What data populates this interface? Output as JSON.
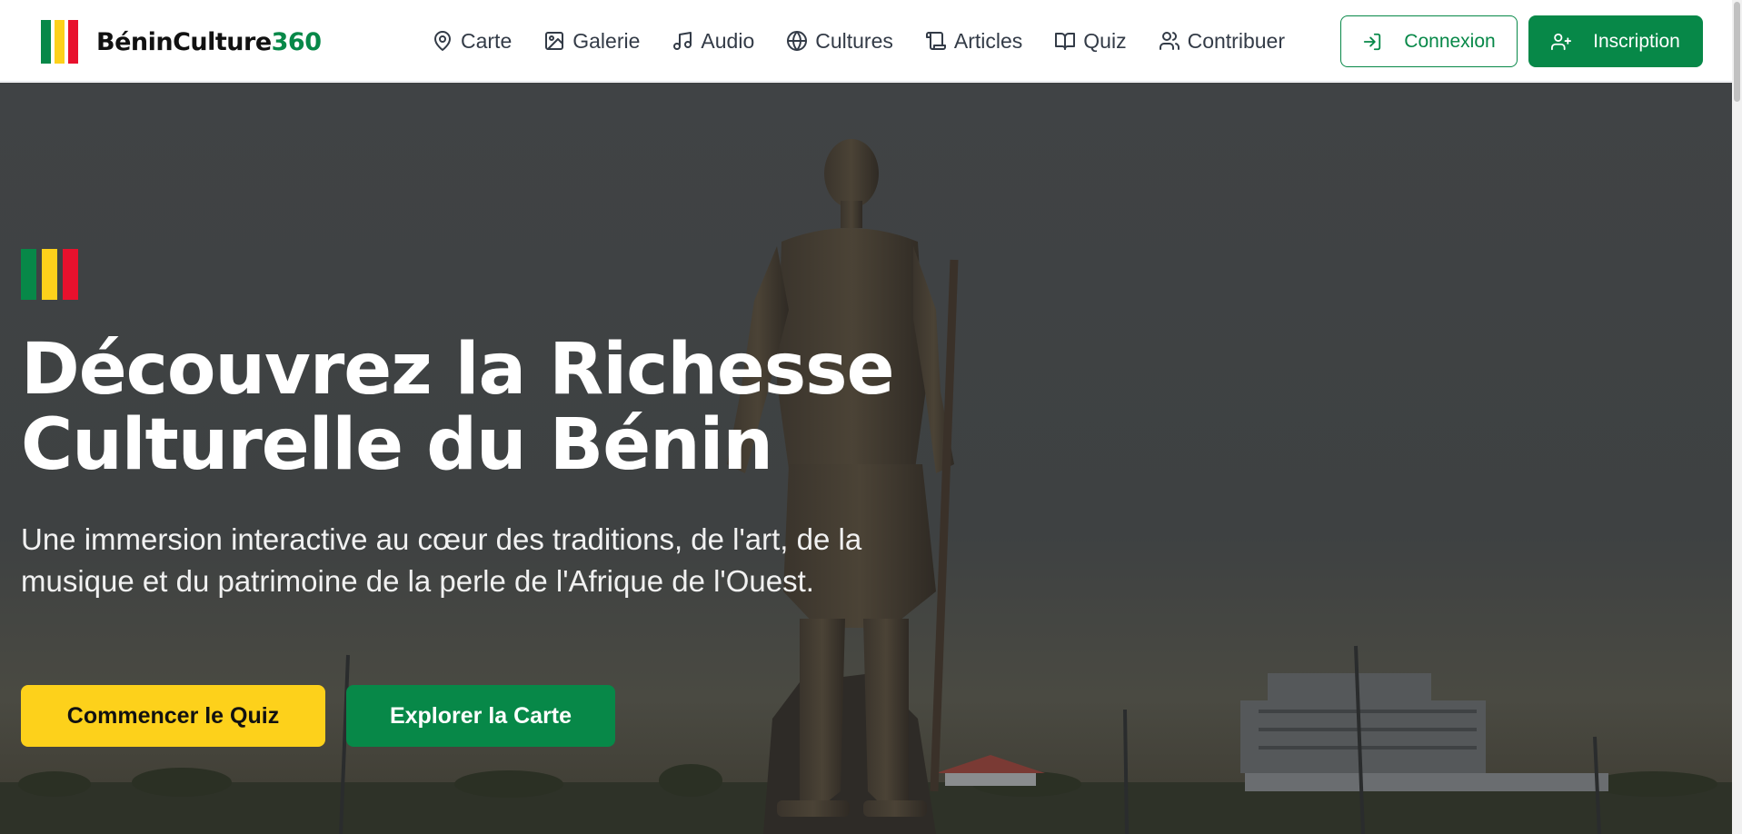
{
  "brand": {
    "name": "BéninCulture",
    "suffix": "360",
    "flag_colors": [
      "#078848",
      "#fdd11b",
      "#e8112d"
    ]
  },
  "nav": {
    "items": [
      {
        "label": "Carte",
        "icon": "map-pin-icon"
      },
      {
        "label": "Galerie",
        "icon": "image-icon"
      },
      {
        "label": "Audio",
        "icon": "music-icon"
      },
      {
        "label": "Cultures",
        "icon": "globe-icon"
      },
      {
        "label": "Articles",
        "icon": "scroll-icon"
      },
      {
        "label": "Quiz",
        "icon": "book-open-icon"
      },
      {
        "label": "Contribuer",
        "icon": "users-icon"
      }
    ],
    "login_label": "Connexion",
    "signup_label": "Inscription"
  },
  "hero": {
    "title_line1": "Découvrez la Richesse",
    "title_line2": "Culturelle du Bénin",
    "subtitle": "Une immersion interactive au cœur des traditions, de l'art, de la musique et du patrimoine de la perle de l'Afrique de l'Ouest.",
    "primary_cta": "Commencer le Quiz",
    "secondary_cta": "Explorer la Carte"
  },
  "colors": {
    "primary_green": "#078848",
    "yellow": "#fdd11b",
    "red": "#e8112d"
  }
}
